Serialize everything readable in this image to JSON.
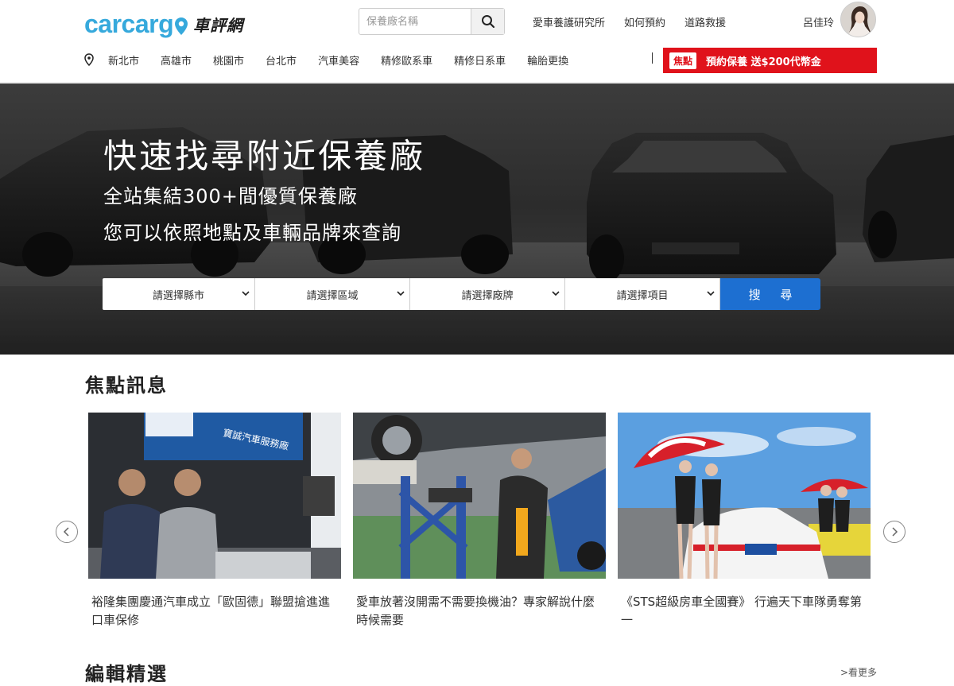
{
  "header": {
    "logo_en": "carcarg",
    "logo_zh": "車評網",
    "search_placeholder": "保養廠名稱",
    "top_links": [
      "愛車養護研究所",
      "如何預約",
      "道路救援"
    ],
    "username": "呂佳玲"
  },
  "subnav": {
    "items": [
      "新北市",
      "高雄市",
      "桃園市",
      "台北市",
      "汽車美容",
      "精修歐系車",
      "精修日系車",
      "輪胎更換"
    ]
  },
  "promo": {
    "tag": "焦點",
    "text": "預約保養 送$200代幣金"
  },
  "hero": {
    "title": "快速找尋附近保養廠",
    "subtitle1": "全站集結300+間優質保養廠",
    "subtitle2": "您可以依照地點及車輛品牌來查詢",
    "selects": [
      "請選擇縣市",
      "請選擇區域",
      "請選擇廠牌",
      "請選擇項目"
    ],
    "search_button": "搜 尋"
  },
  "focus": {
    "title": "焦點訊息",
    "cards": [
      {
        "caption": "裕隆集團慶通汽車成立「歐固德」聯盟搶進進口車保修",
        "sign": "寶誠汽車服務廠"
      },
      {
        "caption": "愛車放著沒開需不需要換機油？專家解說什麼時候需要"
      },
      {
        "caption": "《STS超級房車全國賽》 行遍天下車隊勇奪第一"
      }
    ]
  },
  "editor": {
    "title": "編輯精選",
    "more_label": ">看更多"
  },
  "colors": {
    "brand_blue": "#36a9dc",
    "promo_red": "#e0121b",
    "button_blue": "#1d6fd1"
  }
}
